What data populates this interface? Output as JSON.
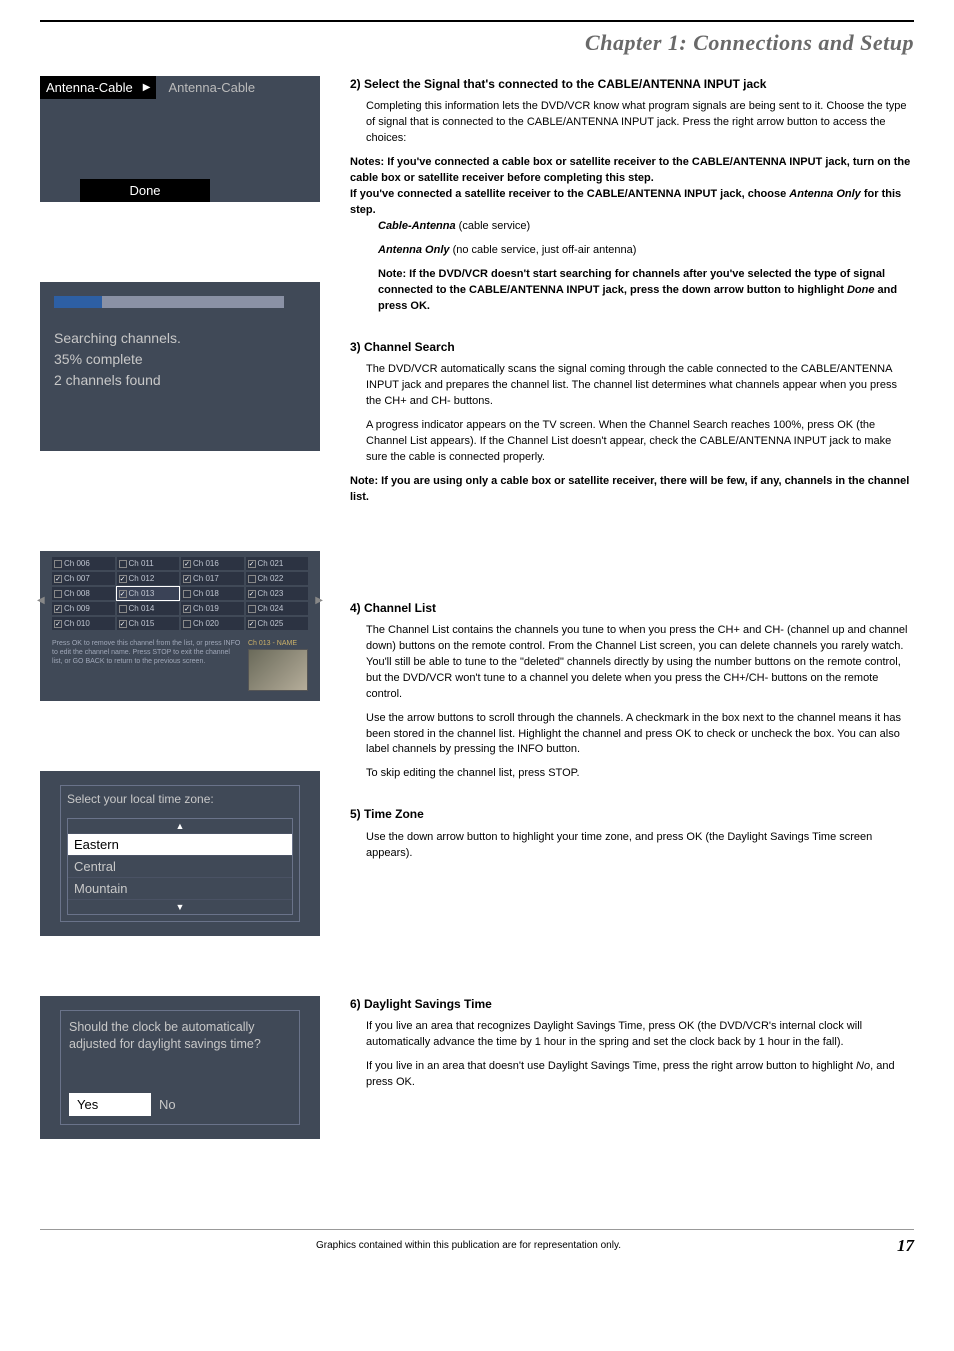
{
  "chapter_title": "Chapter 1: Connections and Setup",
  "antenna": {
    "left_label": "Antenna-Cable",
    "right_label": "Antenna-Cable",
    "done": "Done"
  },
  "search": {
    "line1": "Searching channels.",
    "line2": "35% complete",
    "line3": "2 channels found"
  },
  "channel_list_ui": {
    "cells": [
      {
        "label": "Ch 006",
        "checked": false
      },
      {
        "label": "Ch 011",
        "checked": false
      },
      {
        "label": "Ch 016",
        "checked": true
      },
      {
        "label": "Ch 021",
        "checked": true
      },
      {
        "label": "Ch 007",
        "checked": true
      },
      {
        "label": "Ch 012",
        "checked": true
      },
      {
        "label": "Ch 017",
        "checked": true
      },
      {
        "label": "Ch 022",
        "checked": false
      },
      {
        "label": "Ch 008",
        "checked": false
      },
      {
        "label": "Ch 013",
        "checked": true,
        "sel": true
      },
      {
        "label": "Ch 018",
        "checked": false
      },
      {
        "label": "Ch 023",
        "checked": true
      },
      {
        "label": "Ch 009",
        "checked": true
      },
      {
        "label": "Ch 014",
        "checked": false
      },
      {
        "label": "Ch 019",
        "checked": true
      },
      {
        "label": "Ch 024",
        "checked": false
      },
      {
        "label": "Ch 010",
        "checked": true
      },
      {
        "label": "Ch 015",
        "checked": true
      },
      {
        "label": "Ch 020",
        "checked": false
      },
      {
        "label": "Ch 025",
        "checked": true
      }
    ],
    "info_text": "Press OK to remove this channel from the list, or press INFO to edit the channel name. Press STOP to exit the channel list, or GO BACK to return to the previous screen.",
    "preview_label": "Ch 013 - NAME"
  },
  "timezone": {
    "prompt": "Select your local time zone:",
    "items": [
      "Eastern",
      "Central",
      "Mountain"
    ]
  },
  "dst": {
    "prompt": "Should the clock be automatically adjusted for daylight savings time?",
    "yes": "Yes",
    "no": "No"
  },
  "sections": {
    "s2": {
      "title": "2) Select the Signal that's connected to the CABLE/ANTENNA INPUT jack",
      "p1": "Completing this information lets the DVD/VCR know what program signals are being sent to it. Choose the type of signal that is connected to the CABLE/ANTENNA INPUT jack. Press the right arrow button to access the choices:",
      "note1": "Notes: If you've connected a cable box or satellite receiver to the CABLE/ANTENNA INPUT jack, turn on the cable box or satellite receiver before completing this step.",
      "note2a": "If you've connected a satellite receiver to the CABLE/ANTENNA INPUT jack, choose ",
      "note2b": "Antenna Only",
      "note2c": " for this step.",
      "opt1a": "Cable-Antenna",
      "opt1b": " (cable service)",
      "opt2a": "Antenna Only",
      "opt2b": " (no cable service, just off-air antenna)",
      "opt_note_a": "Note: If the DVD/VCR doesn't start searching for channels after you've selected the type of signal connected to the CABLE/ANTENNA INPUT jack, press the down arrow button to highlight ",
      "opt_note_b": "Done",
      "opt_note_c": " and press OK."
    },
    "s3": {
      "title": "3) Channel Search",
      "p1": "The DVD/VCR automatically scans the signal coming through the cable connected to the CABLE/ANTENNA INPUT jack and prepares the channel list. The channel list determines what channels appear when you press the CH+ and CH- buttons.",
      "p2": "A progress indicator appears on the TV screen. When the Channel Search reaches 100%, press OK (the Channel List appears). If the Channel List doesn't appear, check the CABLE/ANTENNA INPUT jack to make sure the cable is connected properly.",
      "note": "Note: If you are using only a cable box or satellite receiver, there will be few, if any, channels in the channel list."
    },
    "s4": {
      "title": "4) Channel List",
      "p1": "The Channel List contains the channels you tune to when you press the CH+ and CH- (channel up and channel down) buttons on the remote control. From the Channel List screen, you can delete channels you rarely watch. You'll still be able to tune to the \"deleted\" channels directly by using the number buttons on the remote control, but the DVD/VCR won't tune to a channel you delete when you press the CH+/CH- buttons on the remote control.",
      "p2": "Use the  arrow buttons to scroll through the channels. A checkmark in the box next to the channel means it has been stored in the channel list. Highlight the channel and press OK to check or uncheck the box. You can also label channels by pressing the INFO button.",
      "p3": "To skip editing the channel list, press STOP."
    },
    "s5": {
      "title": "5) Time Zone",
      "p1": "Use the down arrow button to highlight your time zone, and press OK (the Daylight Savings Time screen appears)."
    },
    "s6": {
      "title": "6) Daylight Savings Time",
      "p1": "If you live an area that recognizes Daylight Savings Time, press OK (the DVD/VCR's internal clock will automatically advance the time by 1 hour in the spring and set the clock back by 1 hour in the fall).",
      "p2a": "If you live in an area that doesn't use Daylight Savings Time, press the right arrow button to highlight ",
      "p2b": "No",
      "p2c": ", and press OK."
    }
  },
  "footer": {
    "text": "Graphics contained within this publication are for representation only.",
    "page": "17"
  }
}
